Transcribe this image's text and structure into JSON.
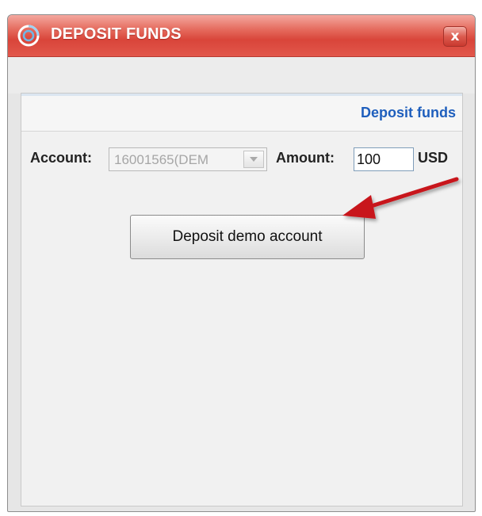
{
  "window": {
    "title": "DEPOSIT FUNDS",
    "close_label": "x"
  },
  "panel": {
    "header_title": "Deposit funds"
  },
  "form": {
    "account_label": "Account:",
    "account_value": "16001565(DEM",
    "amount_label": "Amount:",
    "amount_value": "100",
    "currency": "USD"
  },
  "actions": {
    "deposit_label": "Deposit demo account"
  },
  "colors": {
    "titlebar": "#d9453a",
    "header_link": "#1f5fbd",
    "annotation_arrow": "#c8171c"
  },
  "icons": {
    "app_logo": "app-logo-icon",
    "close": "close-icon",
    "dropdown": "chevron-down-icon",
    "annotation": "red-arrow-annotation"
  }
}
